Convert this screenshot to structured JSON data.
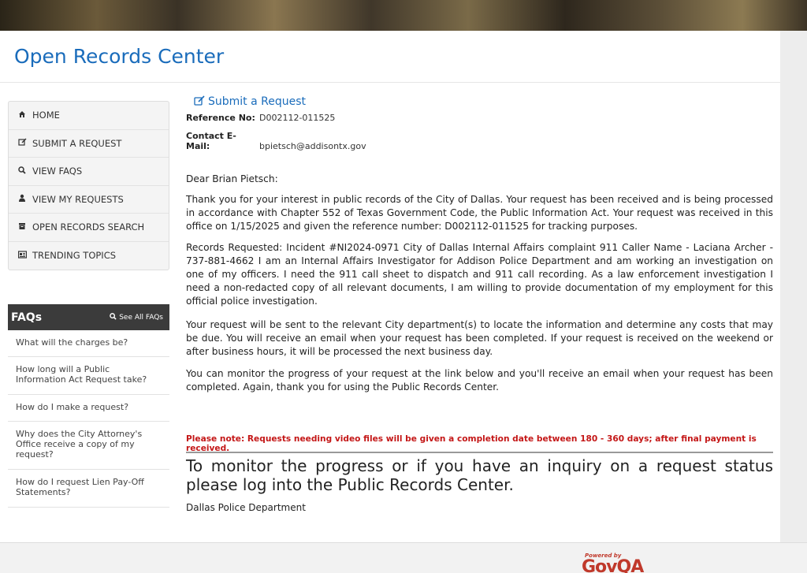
{
  "site": {
    "title": "Open Records Center"
  },
  "nav": {
    "items": [
      {
        "icon": "home-icon",
        "label": "HOME"
      },
      {
        "icon": "edit-icon",
        "label": "SUBMIT A REQUEST"
      },
      {
        "icon": "search-icon",
        "label": "VIEW FAQS"
      },
      {
        "icon": "user-icon",
        "label": "VIEW MY REQUESTS"
      },
      {
        "icon": "archive-icon",
        "label": "OPEN RECORDS SEARCH"
      },
      {
        "icon": "newspaper-icon",
        "label": "TRENDING TOPICS"
      }
    ]
  },
  "faqs": {
    "title": "FAQs",
    "see_all": "See All FAQs",
    "items": [
      "What will the charges be?",
      "How long will a Public Information Act Request take?",
      "How do I make a request?",
      "Why does the City Attorney's Office receive a copy of my request?",
      "How do I request Lien Pay-Off Statements?"
    ]
  },
  "content": {
    "submit_link": "Submit a Request",
    "reference_label": "Reference No:",
    "reference_value": "D002112-011525",
    "email_label": "Contact E-Mail:",
    "email_value": "bpietsch@addisontx.gov",
    "greeting": "Dear Brian Pietsch:",
    "para1": "Thank you for your interest in public records of the City of Dallas. Your request has been received and is being processed in accordance with Chapter 552 of Texas Government Code, the Public Information Act. Your request was received in this office on 1/15/2025 and given the reference number: D002112-011525 for tracking purposes.",
    "para2": "Records Requested: Incident #NI2024-0971 City of Dallas Internal Affairs complaint 911 Caller Name - Laciana Archer - 737-881-4662 I am an Internal Affairs Investigator for Addison Police Department and am working an investigation on one of my officers. I need the 911 call sheet to dispatch and 911 call recording. As a law enforcement investigation I need a non-redacted copy of all relevant documents, I am willing to provide documentation of my employment for this official police investigation.",
    "para3": "Your request will be sent to the relevant City department(s) to locate the information and determine any costs that may be due. You will receive an email when your request has been completed. If your request is received on the weekend or after business hours, it will be processed the next business day.",
    "para4": "You can monitor the progress of your request at the link below and you'll receive an email when your request has been completed. Again, thank you for using the Public Records Center.",
    "note": "Please note: Requests needing video files will be given a completion date between 180 - 360 days; after final payment is received.",
    "big_text": "To monitor the progress or if you have an inquiry on a request status please log into the Public Records Center.",
    "dept": "Dallas Police Department"
  },
  "footer": {
    "powered_by": "Powered by",
    "brand": "GovQA"
  }
}
